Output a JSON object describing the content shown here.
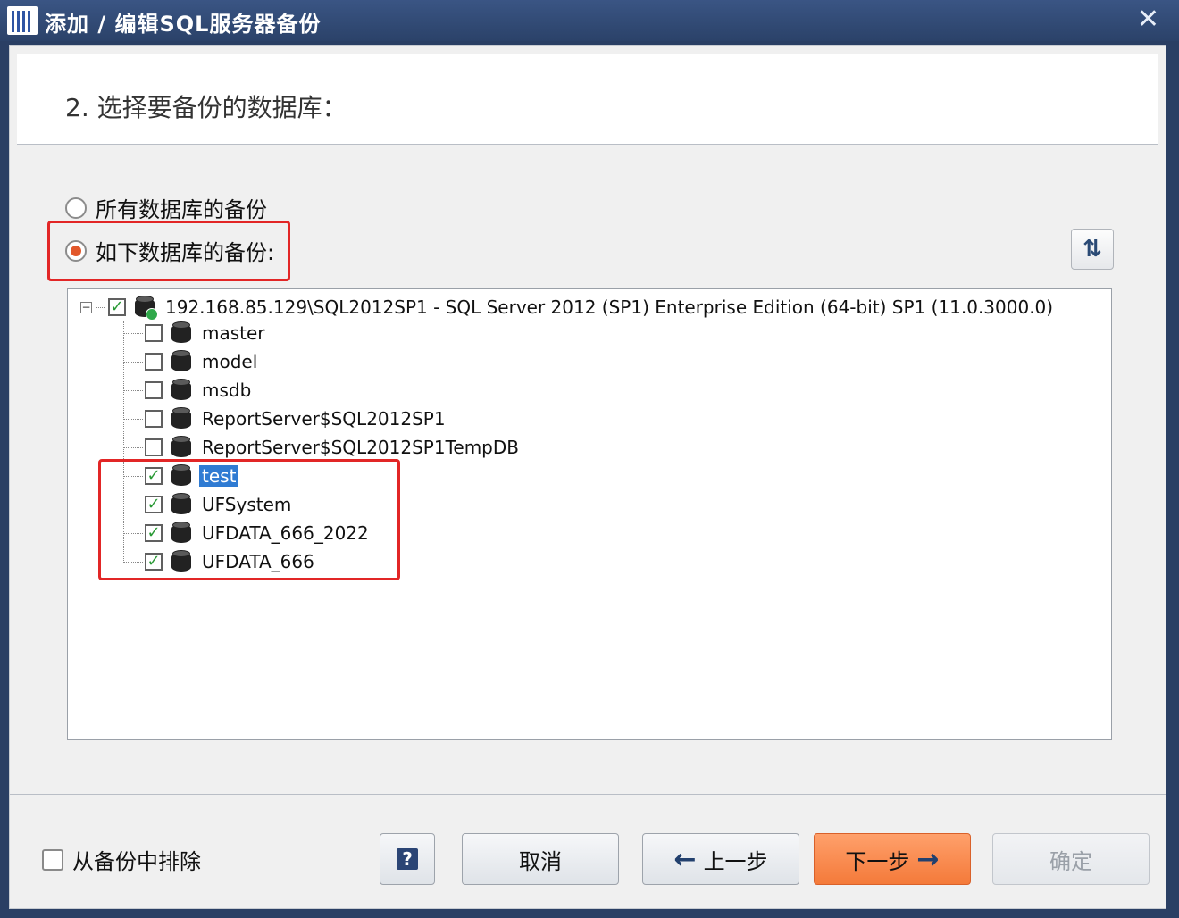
{
  "window": {
    "title": "添加 / 编辑SQL服务器备份",
    "close_glyph": "✕"
  },
  "header": {
    "step_title": "2. 选择要备份的数据库："
  },
  "options": {
    "all_databases_label": "所有数据库的备份",
    "all_databases_selected": false,
    "selected_databases_label": "如下数据库的备份:",
    "selected_databases_selected": true
  },
  "refresh": {
    "icon": "refresh-icon",
    "glyph": "⇅"
  },
  "tree": {
    "root": {
      "label": "192.168.85.129\\SQL2012SP1 - SQL Server 2012 (SP1) Enterprise Edition (64-bit) SP1 (11.0.3000.0)",
      "checked": true,
      "expanded": true
    },
    "items": [
      {
        "label": "master",
        "checked": false,
        "selected": false
      },
      {
        "label": "model",
        "checked": false,
        "selected": false
      },
      {
        "label": "msdb",
        "checked": false,
        "selected": false
      },
      {
        "label": "ReportServer$SQL2012SP1",
        "checked": false,
        "selected": false
      },
      {
        "label": "ReportServer$SQL2012SP1TempDB",
        "checked": false,
        "selected": false
      },
      {
        "label": "test",
        "checked": true,
        "selected": true
      },
      {
        "label": "UFSystem",
        "checked": true,
        "selected": false
      },
      {
        "label": "UFDATA_666_2022",
        "checked": true,
        "selected": false
      },
      {
        "label": "UFDATA_666",
        "checked": true,
        "selected": false
      }
    ]
  },
  "footer": {
    "exclude_label": "从备份中排除",
    "help_glyph": "?",
    "cancel_label": "取消",
    "back_label": "上一步",
    "next_label": "下一步",
    "ok_label": "确定"
  },
  "colors": {
    "accent_orange": "#f47a3a",
    "highlight_red": "#e22626",
    "selection_blue": "#2f7bd3",
    "title_bar": "#2b4269"
  }
}
